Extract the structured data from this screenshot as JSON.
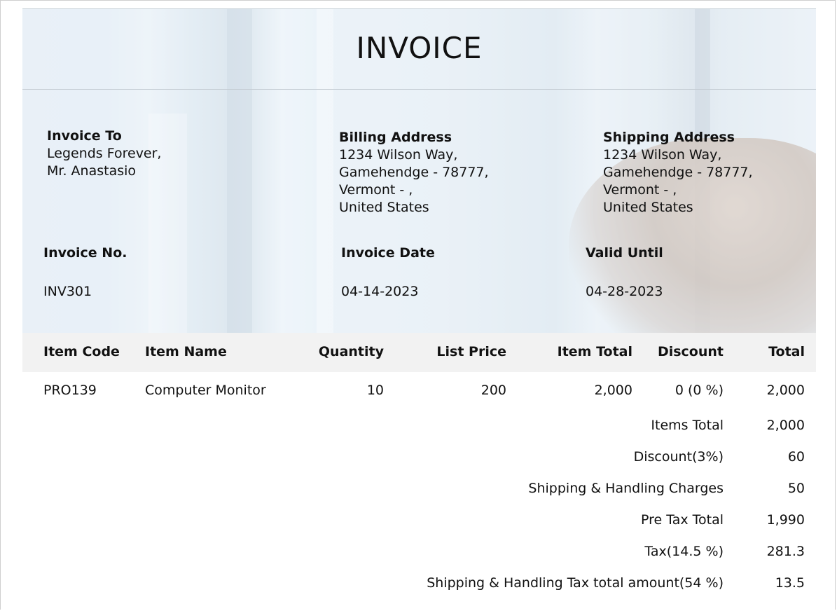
{
  "title": "INVOICE",
  "invoice_to": {
    "heading": "Invoice To",
    "lines": [
      "Legends Forever,",
      "Mr. Anastasio"
    ]
  },
  "billing_address": {
    "heading": "Billing Address",
    "lines": [
      "1234 Wilson Way,",
      "Gamehendge - 78777,",
      "Vermont  - ,",
      "United States"
    ]
  },
  "shipping_address": {
    "heading": "Shipping Address",
    "lines": [
      "1234 Wilson Way,",
      "Gamehendge - 78777,",
      "Vermont  - ,",
      "United States"
    ]
  },
  "meta": {
    "invoice_no_label": "Invoice No.",
    "invoice_no": "INV301",
    "invoice_date_label": "Invoice Date",
    "invoice_date": "04-14-2023",
    "valid_until_label": "Valid Until",
    "valid_until": "04-28-2023"
  },
  "table": {
    "headers": [
      "Item Code",
      "Item Name",
      "Quantity",
      "List Price",
      "Item Total",
      "Discount",
      "Total"
    ],
    "rows": [
      [
        "PRO139",
        "Computer Monitor",
        "10",
        "200",
        "2,000",
        "0 (0 %)",
        "2,000"
      ]
    ]
  },
  "summary": [
    {
      "label": "Items Total",
      "value": "2,000"
    },
    {
      "label": "Discount(3%)",
      "value": "60"
    },
    {
      "label": "Shipping & Handling Charges",
      "value": "50"
    },
    {
      "label": "Pre Tax Total",
      "value": "1,990"
    },
    {
      "label": "Tax(14.5 %)",
      "value": "281.3"
    },
    {
      "label": "Shipping & Handling Tax total amount(54 %)",
      "value": "13.5"
    }
  ]
}
